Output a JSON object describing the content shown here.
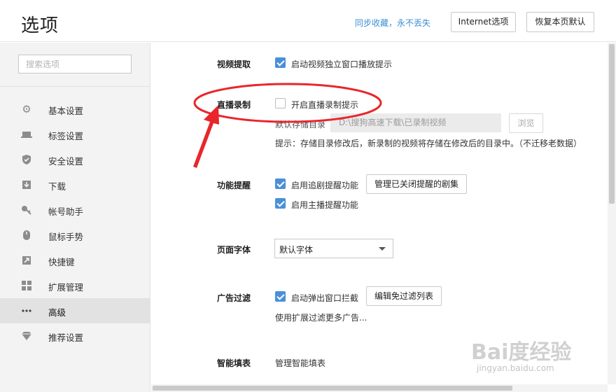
{
  "header": {
    "title": "选项",
    "sync_link": "同步收藏，永不丢失",
    "internet_options": "Internet选项",
    "restore_defaults": "恢复本页默认"
  },
  "sidebar": {
    "search_placeholder": "搜索选项",
    "items": [
      {
        "label": "基本设置",
        "icon": "gear-icon",
        "active": false
      },
      {
        "label": "标签设置",
        "icon": "tab-icon",
        "active": false
      },
      {
        "label": "安全设置",
        "icon": "shield-icon",
        "active": false
      },
      {
        "label": "下载",
        "icon": "download-icon",
        "active": false
      },
      {
        "label": "帐号助手",
        "icon": "key-icon",
        "active": false
      },
      {
        "label": "鼠标手势",
        "icon": "mouse-icon",
        "active": false
      },
      {
        "label": "快捷键",
        "icon": "shortcut-icon",
        "active": false
      },
      {
        "label": "扩展管理",
        "icon": "extensions-icon",
        "active": false
      },
      {
        "label": "高级",
        "icon": "more-icon",
        "active": true
      },
      {
        "label": "推荐设置",
        "icon": "diamond-icon",
        "active": false
      }
    ]
  },
  "main": {
    "video": {
      "title": "视频提取",
      "option": "启动视频独立窗口播放提示",
      "checked": true
    },
    "live_record": {
      "title": "直播录制",
      "option": "开启直播录制提示",
      "checked": false,
      "storage_label": "默认存储目录",
      "storage_path": "D:\\搜狗高速下载\\已录制视频",
      "browse": "浏览",
      "hint": "提示：存储目录修改后，新录制的视频将存储在修改后的目录中。（不迁移老数据）"
    },
    "feature_reminder": {
      "title": "功能提醒",
      "option1": "启用追剧提醒功能",
      "option1_checked": true,
      "manage_button": "管理已关闭提醒的剧集",
      "option2": "启用主播提醒功能",
      "option2_checked": true
    },
    "font": {
      "title": "页面字体",
      "selected": "默认字体"
    },
    "ad_filter": {
      "title": "广告过滤",
      "option": "启动弹出窗口拦截",
      "checked": true,
      "edit_button": "编辑免过滤列表",
      "hint": "使用扩展过滤更多广告..."
    },
    "autofill": {
      "title": "智能填表",
      "link": "管理智能填表"
    }
  },
  "annotation": {
    "color": "#e8262b"
  },
  "watermark": {
    "brand": "Bai度经验",
    "url": "jingyan.baidu.com"
  }
}
